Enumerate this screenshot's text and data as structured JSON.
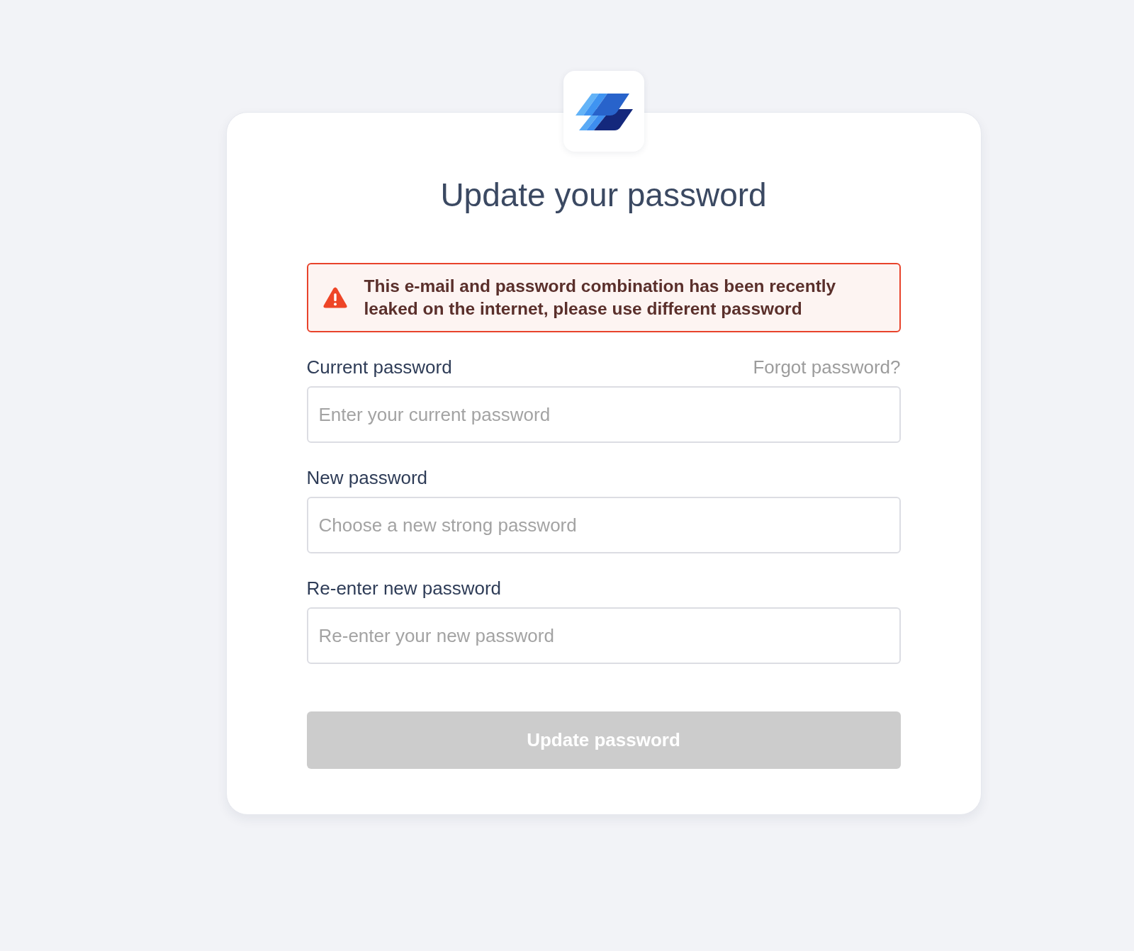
{
  "title": "Update your password",
  "alert": {
    "kind": "error",
    "message": "This e-mail and password combination has been recently leaked on the internet, please use different password"
  },
  "fields": [
    {
      "label": "Current password",
      "link": "Forgot password?",
      "placeholder": "Enter your current password"
    },
    {
      "label": "New password",
      "placeholder": "Choose a new strong password"
    },
    {
      "label": "Re-enter new password",
      "placeholder": "Re-enter your new password"
    }
  ],
  "submit": {
    "label": "Update password",
    "disabled": true
  }
}
